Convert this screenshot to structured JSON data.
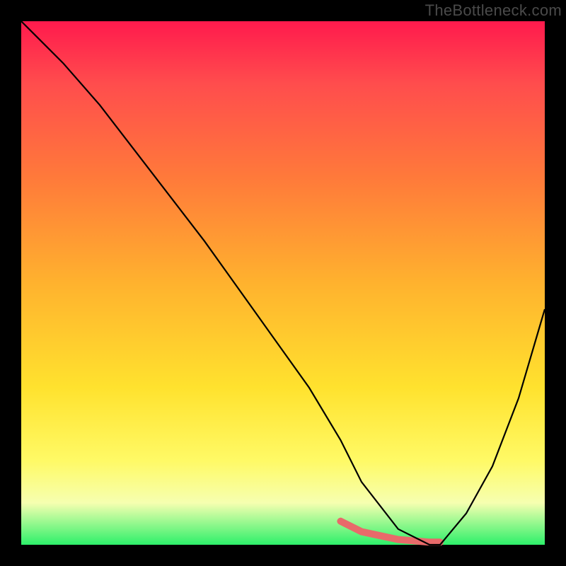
{
  "watermark": "TheBottleneck.com",
  "chart_data": {
    "type": "line",
    "title": "",
    "xlabel": "",
    "ylabel": "",
    "xlim": [
      0,
      100
    ],
    "ylim": [
      0,
      100
    ],
    "legend": false,
    "grid": false,
    "annotations": [],
    "background_gradient": {
      "direction": "vertical",
      "stops": [
        {
          "pos": 0.0,
          "color": "#ff1a4d"
        },
        {
          "pos": 0.12,
          "color": "#ff4d4d"
        },
        {
          "pos": 0.3,
          "color": "#ff7a3a"
        },
        {
          "pos": 0.5,
          "color": "#ffb22e"
        },
        {
          "pos": 0.7,
          "color": "#ffe22e"
        },
        {
          "pos": 0.84,
          "color": "#fffa66"
        },
        {
          "pos": 0.92,
          "color": "#f6ffb0"
        },
        {
          "pos": 1.0,
          "color": "#2df06a"
        }
      ]
    },
    "series": [
      {
        "name": "curve",
        "color": "#000000",
        "x": [
          0,
          3,
          8,
          15,
          25,
          35,
          45,
          55,
          61,
          65,
          72,
          78,
          80,
          85,
          90,
          95,
          100
        ],
        "y": [
          100,
          97,
          92,
          84,
          71,
          58,
          44,
          30,
          20,
          12,
          3,
          0,
          0,
          6,
          15,
          28,
          45
        ]
      },
      {
        "name": "highlight",
        "color": "#e86a6a",
        "stroke_width": 7,
        "x": [
          61,
          65,
          72,
          78,
          80
        ],
        "y": [
          4.5,
          2.5,
          1.0,
          0.5,
          0.5
        ]
      }
    ]
  }
}
